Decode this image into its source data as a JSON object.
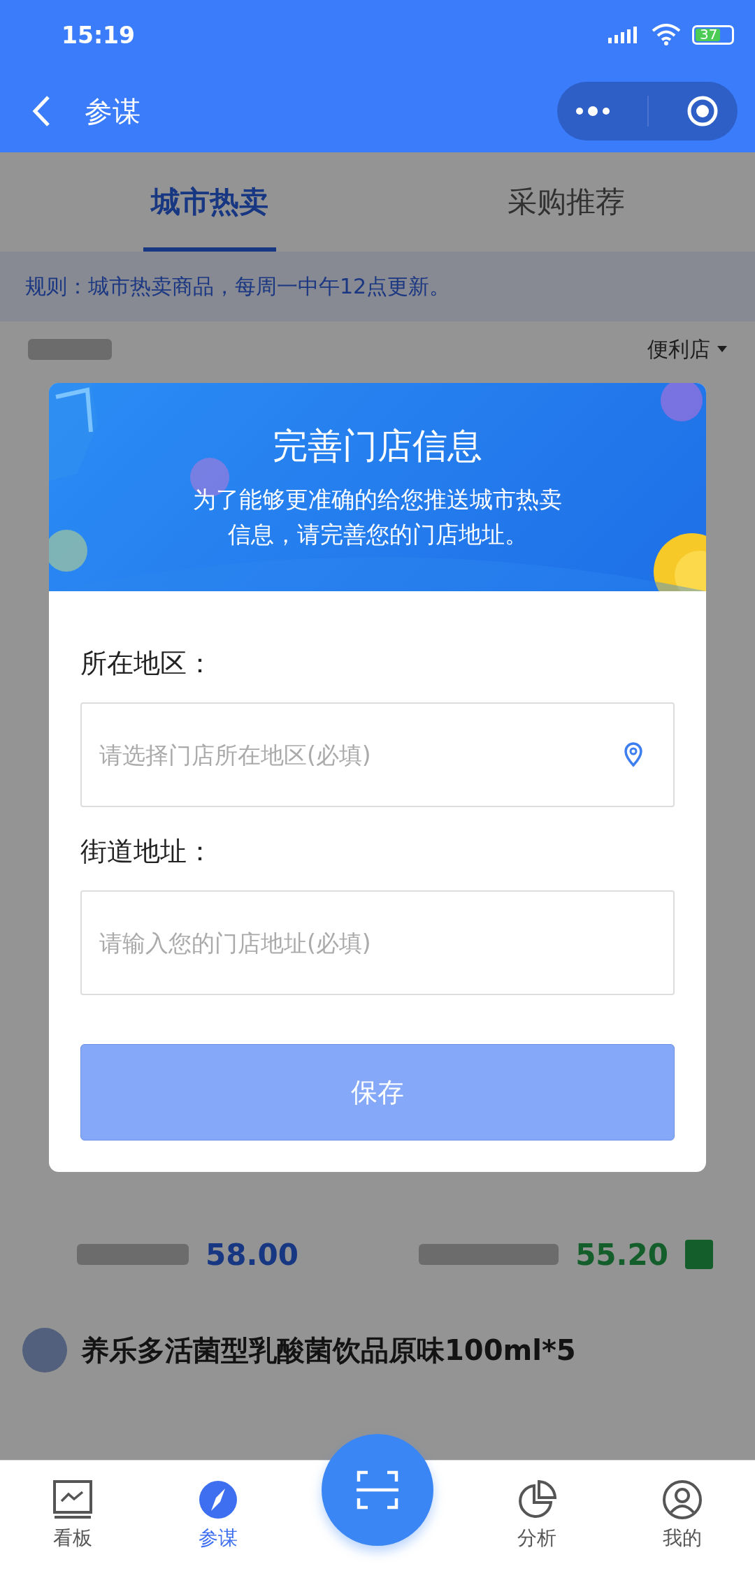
{
  "status_bar": {
    "time": "15:19",
    "battery": "37"
  },
  "nav": {
    "title": "参谋"
  },
  "background": {
    "tabs": [
      {
        "label": "城市热卖",
        "selected": true
      },
      {
        "label": "采购推荐",
        "selected": false
      }
    ],
    "notice": "规则：城市热卖商品，每周一中午12点更新。",
    "filter": "便利店",
    "price_row": {
      "value_1": "58.00",
      "value_2": "55.20"
    },
    "product": {
      "name": "养乐多活菌型乳酸菌饮品原味100ml*5"
    }
  },
  "modal": {
    "title": "完善门店信息",
    "subtitle": "为了能够更准确的给您推送城市热卖信息，请完善您的门店地址。",
    "fields": [
      {
        "label": "所在地区：",
        "placeholder": "请选择门店所在地区(必填)",
        "kind": "location"
      },
      {
        "label": "街道地址：",
        "placeholder": "请输入您的门店地址(必填)",
        "kind": "text"
      }
    ],
    "save_button": "保存"
  },
  "tab_bar": [
    {
      "label": "看板",
      "selected": false
    },
    {
      "label": "参谋",
      "selected": true
    },
    {
      "kind": "scan"
    },
    {
      "label": "分析",
      "selected": false
    },
    {
      "label": "我的",
      "selected": false
    }
  ]
}
